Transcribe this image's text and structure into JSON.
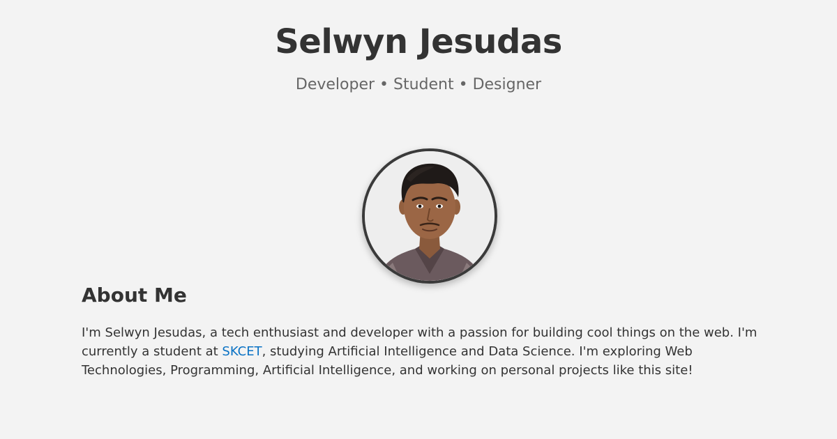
{
  "profile": {
    "name": "Selwyn Jesudas",
    "tagline": "Developer • Student • Designer"
  },
  "about": {
    "title": "About Me",
    "text_before_link": "I'm Selwyn Jesudas, a tech enthusiast and developer with a passion for building cool things on the web. I'm currently a student at ",
    "link_text": "SKCET",
    "text_after_link": ", studying Artificial Intelligence and Data Science. I'm exploring Web Technologies, Programming, Artificial Intelligence, and working on personal projects like this site!"
  },
  "colors": {
    "background": "#f3f3f3",
    "text": "#333333",
    "subtle_text": "#666666",
    "link": "#0a72c4",
    "avatar_border": "#3a3a3a"
  }
}
